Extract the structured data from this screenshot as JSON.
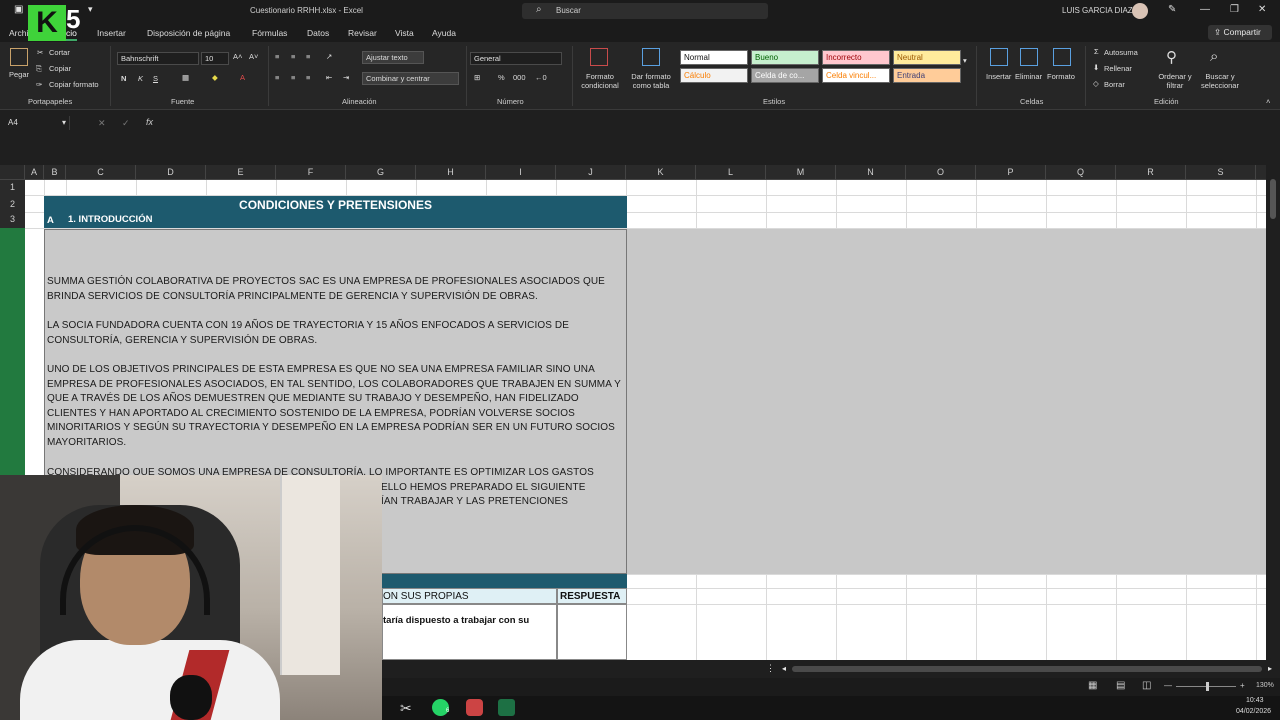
{
  "window": {
    "title": "Cuestionario RRHH.xlsx  -  Excel",
    "search_placeholder": "Buscar",
    "user": "LUIS GARCIA DIAZ"
  },
  "menu": {
    "items": [
      "Archivo",
      "Inicio",
      "Insertar",
      "Disposición de página",
      "Fórmulas",
      "Datos",
      "Revisar",
      "Vista",
      "Ayuda"
    ],
    "active": "Inicio",
    "share": "Compartir"
  },
  "ribbon": {
    "clipboard": {
      "paste": "Pegar",
      "cut": "Cortar",
      "copy": "Copiar",
      "format_painter": "Copiar formato",
      "group": "Portapapeles"
    },
    "font": {
      "name": "Bahnschrift",
      "size": "10",
      "group": "Fuente"
    },
    "alignment": {
      "wrap": "Ajustar texto",
      "merge": "Combinar y centrar",
      "group": "Alineación"
    },
    "number": {
      "format": "General",
      "group": "Número"
    },
    "styles": {
      "conditional": "Formato condicional",
      "as_table": "Dar formato como tabla",
      "cells": [
        "Normal",
        "Bueno",
        "Incorrecto",
        "Neutral",
        "Cálculo",
        "Celda de co...",
        "Celda vincul...",
        "Entrada"
      ],
      "group": "Estilos"
    },
    "cells": {
      "insert": "Insertar",
      "delete": "Eliminar",
      "format": "Formato",
      "group": "Celdas"
    },
    "editing": {
      "autosum": "Autosuma",
      "fill": "Rellenar",
      "clear": "Borrar",
      "sort": "Ordenar y filtrar",
      "find": "Buscar y seleccionar",
      "group": "Edición"
    }
  },
  "formula_bar": {
    "name_box": "A4",
    "fx": "fx"
  },
  "columns": [
    "A",
    "B",
    "C",
    "D",
    "E",
    "F",
    "G",
    "H",
    "I",
    "J",
    "K",
    "L",
    "M",
    "N",
    "O",
    "P",
    "Q",
    "R",
    "S"
  ],
  "rows": [
    "1",
    "2",
    "3"
  ],
  "sheet": {
    "banner": "CONDICIONES Y PRETENSIONES",
    "section_letter": "A",
    "section_title": "1. INTRODUCCIÓN",
    "paragraphs": [
      "SUMMA GESTIÓN COLABORATIVA DE PROYECTOS SAC ES UNA EMPRESA DE PROFESIONALES ASOCIADOS QUE BRINDA SERVICIOS DE CONSULTORÍA PRINCIPALMENTE DE GERENCIA Y SUPERVISIÓN DE OBRAS.",
      "LA SOCIA FUNDADORA CUENTA CON 19 AÑOS DE TRAYECTORIA Y 15 AÑOS ENFOCADOS A SERVICIOS DE CONSULTORÍA, GERENCIA Y SUPERVISIÓN DE OBRAS.",
      "UNO DE LOS OBJETIVOS PRINCIPALES DE ESTA EMPRESA ES QUE NO SEA UNA EMPRESA FAMILIAR SINO UNA EMPRESA DE PROFESIONALES ASOCIADOS, EN TAL SENTIDO, LOS COLABORADORES QUE TRABAJEN EN SUMMA Y QUE A TRAVÉS DE LOS AÑOS DEMUESTREN QUE MEDIANTE SU TRABAJO Y DESEMPEÑO, HAN FIDELIZADO CLIENTES Y HAN APORTADO AL CRECIMIENTO SOSTENIDO DE LA EMPRESA, PODRÍAN VOLVERSE SOCIOS MINORITARIOS Y SEGÚN SU TRAYECTORIA Y DESEMPEÑO EN LA EMPRESA PODRÍAN SER EN UN FUTURO SOCIOS MAYORITARIOS.",
      "CONSIDERANDO QUE SOMOS UNA EMPRESA DE CONSULTORÍA, LO IMPORTANTE ES OPTIMIZAR LOS GASTOS",
      "ELLO HEMOS PREPARADO EL SIGUIENTE",
      "ÍAN TRABAJAR Y LAS PRETENCIONES"
    ],
    "question_header": "ON SUS PROPIAS",
    "answer_header": "RESPUESTA",
    "question_1": "taría dispuesto a trabajar con su"
  },
  "status": {
    "zoom": "130%"
  },
  "taskbar": {
    "time": "10:43",
    "date": "04/02/2026",
    "whatsapp_badge": "6"
  },
  "overlay": {
    "logo_letter": "K",
    "logo_number": "5"
  },
  "colors": {
    "accent": "#227a3f",
    "banner": "#1d5a6e",
    "highlight": "#c9c9c9"
  }
}
